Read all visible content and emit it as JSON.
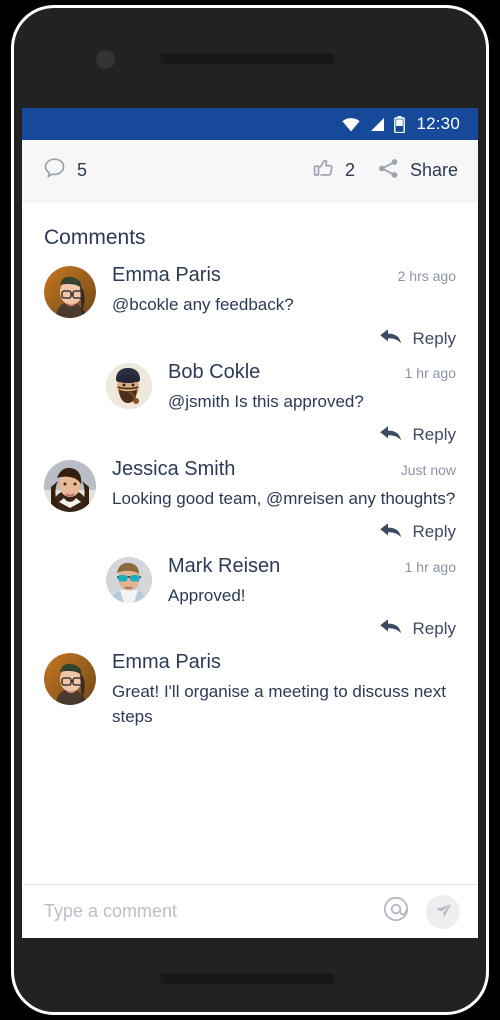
{
  "device": {
    "camera_icon": "front-camera",
    "speaker_icon": "earpiece-speaker"
  },
  "status_bar": {
    "time": "12:30",
    "background": "#17499b",
    "icons": [
      "wifi-icon",
      "cellular-signal-icon",
      "battery-icon"
    ]
  },
  "action_bar": {
    "comment_icon": "comment-bubble-icon",
    "comment_count": "5",
    "like_icon": "thumbs-up-icon",
    "like_count": "2",
    "share_icon": "share-icon",
    "share_label": "Share"
  },
  "main": {
    "section_title": "Comments",
    "reply_label": "Reply",
    "reply_icon": "reply-arrow-icon",
    "comments": [
      {
        "author": "Emma Paris",
        "time": "2 hrs ago",
        "text": "@bcokle  any feedback?",
        "avatar": "avatar-emma-paris",
        "indented": false
      },
      {
        "author": "Bob Cokle",
        "time": "1 hr ago",
        "text": "@jsmith  Is this approved?",
        "avatar": "avatar-bob-cokle",
        "indented": true
      },
      {
        "author": "Jessica Smith",
        "time": "Just now",
        "text": "Looking good team, @mreisen any thoughts?",
        "avatar": "avatar-jessica-smith",
        "indented": false
      },
      {
        "author": "Mark Reisen",
        "time": "1 hr ago",
        "text": "Approved!",
        "avatar": "avatar-mark-reisen",
        "indented": true
      },
      {
        "author": "Emma Paris",
        "time": "",
        "text": "Great! I'll organise a meeting to discuss next steps",
        "avatar": "avatar-emma-paris",
        "indented": false
      }
    ]
  },
  "fab": {
    "icon": "pencil-icon",
    "color": "#00b5d8"
  },
  "composer": {
    "value": "",
    "placeholder": "Type a comment",
    "mention_icon": "at-mention-icon",
    "send_icon": "send-paper-plane-icon"
  },
  "nav_bar": {
    "back_icon": "back-triangle-icon",
    "home_icon": "home-circle-icon",
    "recents_icon": "recents-square-icon"
  }
}
